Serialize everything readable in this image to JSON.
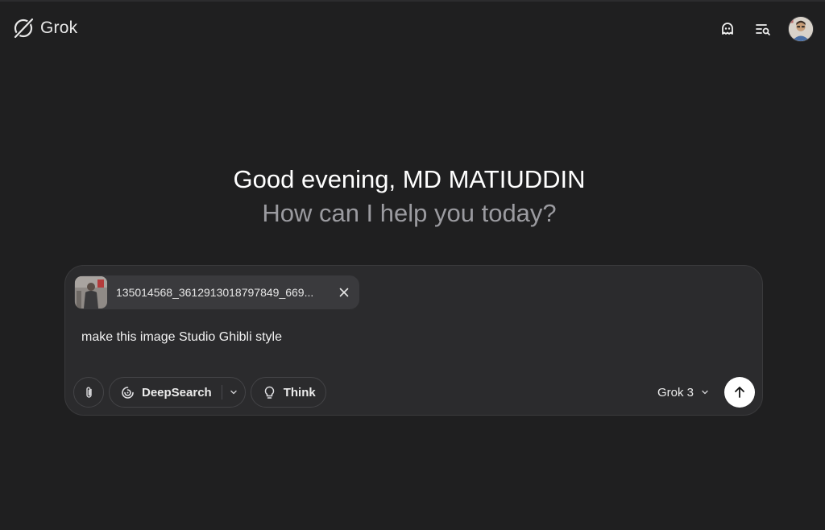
{
  "header": {
    "brand": "Grok",
    "icons": [
      "grok-logo-icon",
      "ghost-icon",
      "history-search-icon",
      "avatar"
    ]
  },
  "greeting": {
    "line1": "Good evening, MD MATIUDDIN",
    "line2": "How can I help you today?"
  },
  "composer": {
    "attachment": {
      "filename": "135014568_3612913018797849_669..."
    },
    "prompt_value": "make this image Studio Ghibli style",
    "tools": {
      "deepsearch_label": "DeepSearch",
      "think_label": "Think"
    },
    "model": {
      "selected": "Grok 3"
    }
  },
  "colors": {
    "background": "#1f1f20",
    "composer_bg": "#2b2b2d",
    "chip_bg": "#3a3a3d",
    "muted_text": "#9b9ba0",
    "send_button": "#ffffff"
  }
}
